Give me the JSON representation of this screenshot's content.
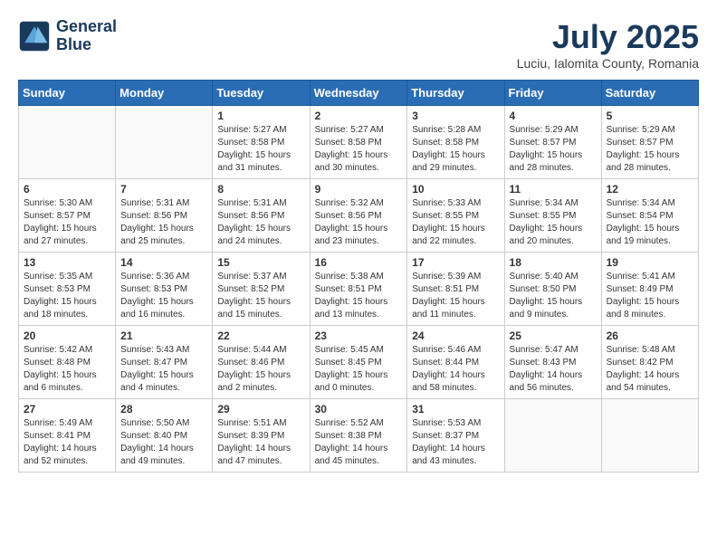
{
  "header": {
    "logo_line1": "General",
    "logo_line2": "Blue",
    "month_title": "July 2025",
    "location": "Luciu, Ialomita County, Romania"
  },
  "weekdays": [
    "Sunday",
    "Monday",
    "Tuesday",
    "Wednesday",
    "Thursday",
    "Friday",
    "Saturday"
  ],
  "weeks": [
    [
      {
        "day": "",
        "sunrise": "",
        "sunset": "",
        "daylight": ""
      },
      {
        "day": "",
        "sunrise": "",
        "sunset": "",
        "daylight": ""
      },
      {
        "day": "1",
        "sunrise": "Sunrise: 5:27 AM",
        "sunset": "Sunset: 8:58 PM",
        "daylight": "Daylight: 15 hours and 31 minutes."
      },
      {
        "day": "2",
        "sunrise": "Sunrise: 5:27 AM",
        "sunset": "Sunset: 8:58 PM",
        "daylight": "Daylight: 15 hours and 30 minutes."
      },
      {
        "day": "3",
        "sunrise": "Sunrise: 5:28 AM",
        "sunset": "Sunset: 8:58 PM",
        "daylight": "Daylight: 15 hours and 29 minutes."
      },
      {
        "day": "4",
        "sunrise": "Sunrise: 5:29 AM",
        "sunset": "Sunset: 8:57 PM",
        "daylight": "Daylight: 15 hours and 28 minutes."
      },
      {
        "day": "5",
        "sunrise": "Sunrise: 5:29 AM",
        "sunset": "Sunset: 8:57 PM",
        "daylight": "Daylight: 15 hours and 28 minutes."
      }
    ],
    [
      {
        "day": "6",
        "sunrise": "Sunrise: 5:30 AM",
        "sunset": "Sunset: 8:57 PM",
        "daylight": "Daylight: 15 hours and 27 minutes."
      },
      {
        "day": "7",
        "sunrise": "Sunrise: 5:31 AM",
        "sunset": "Sunset: 8:56 PM",
        "daylight": "Daylight: 15 hours and 25 minutes."
      },
      {
        "day": "8",
        "sunrise": "Sunrise: 5:31 AM",
        "sunset": "Sunset: 8:56 PM",
        "daylight": "Daylight: 15 hours and 24 minutes."
      },
      {
        "day": "9",
        "sunrise": "Sunrise: 5:32 AM",
        "sunset": "Sunset: 8:56 PM",
        "daylight": "Daylight: 15 hours and 23 minutes."
      },
      {
        "day": "10",
        "sunrise": "Sunrise: 5:33 AM",
        "sunset": "Sunset: 8:55 PM",
        "daylight": "Daylight: 15 hours and 22 minutes."
      },
      {
        "day": "11",
        "sunrise": "Sunrise: 5:34 AM",
        "sunset": "Sunset: 8:55 PM",
        "daylight": "Daylight: 15 hours and 20 minutes."
      },
      {
        "day": "12",
        "sunrise": "Sunrise: 5:34 AM",
        "sunset": "Sunset: 8:54 PM",
        "daylight": "Daylight: 15 hours and 19 minutes."
      }
    ],
    [
      {
        "day": "13",
        "sunrise": "Sunrise: 5:35 AM",
        "sunset": "Sunset: 8:53 PM",
        "daylight": "Daylight: 15 hours and 18 minutes."
      },
      {
        "day": "14",
        "sunrise": "Sunrise: 5:36 AM",
        "sunset": "Sunset: 8:53 PM",
        "daylight": "Daylight: 15 hours and 16 minutes."
      },
      {
        "day": "15",
        "sunrise": "Sunrise: 5:37 AM",
        "sunset": "Sunset: 8:52 PM",
        "daylight": "Daylight: 15 hours and 15 minutes."
      },
      {
        "day": "16",
        "sunrise": "Sunrise: 5:38 AM",
        "sunset": "Sunset: 8:51 PM",
        "daylight": "Daylight: 15 hours and 13 minutes."
      },
      {
        "day": "17",
        "sunrise": "Sunrise: 5:39 AM",
        "sunset": "Sunset: 8:51 PM",
        "daylight": "Daylight: 15 hours and 11 minutes."
      },
      {
        "day": "18",
        "sunrise": "Sunrise: 5:40 AM",
        "sunset": "Sunset: 8:50 PM",
        "daylight": "Daylight: 15 hours and 9 minutes."
      },
      {
        "day": "19",
        "sunrise": "Sunrise: 5:41 AM",
        "sunset": "Sunset: 8:49 PM",
        "daylight": "Daylight: 15 hours and 8 minutes."
      }
    ],
    [
      {
        "day": "20",
        "sunrise": "Sunrise: 5:42 AM",
        "sunset": "Sunset: 8:48 PM",
        "daylight": "Daylight: 15 hours and 6 minutes."
      },
      {
        "day": "21",
        "sunrise": "Sunrise: 5:43 AM",
        "sunset": "Sunset: 8:47 PM",
        "daylight": "Daylight: 15 hours and 4 minutes."
      },
      {
        "day": "22",
        "sunrise": "Sunrise: 5:44 AM",
        "sunset": "Sunset: 8:46 PM",
        "daylight": "Daylight: 15 hours and 2 minutes."
      },
      {
        "day": "23",
        "sunrise": "Sunrise: 5:45 AM",
        "sunset": "Sunset: 8:45 PM",
        "daylight": "Daylight: 15 hours and 0 minutes."
      },
      {
        "day": "24",
        "sunrise": "Sunrise: 5:46 AM",
        "sunset": "Sunset: 8:44 PM",
        "daylight": "Daylight: 14 hours and 58 minutes."
      },
      {
        "day": "25",
        "sunrise": "Sunrise: 5:47 AM",
        "sunset": "Sunset: 8:43 PM",
        "daylight": "Daylight: 14 hours and 56 minutes."
      },
      {
        "day": "26",
        "sunrise": "Sunrise: 5:48 AM",
        "sunset": "Sunset: 8:42 PM",
        "daylight": "Daylight: 14 hours and 54 minutes."
      }
    ],
    [
      {
        "day": "27",
        "sunrise": "Sunrise: 5:49 AM",
        "sunset": "Sunset: 8:41 PM",
        "daylight": "Daylight: 14 hours and 52 minutes."
      },
      {
        "day": "28",
        "sunrise": "Sunrise: 5:50 AM",
        "sunset": "Sunset: 8:40 PM",
        "daylight": "Daylight: 14 hours and 49 minutes."
      },
      {
        "day": "29",
        "sunrise": "Sunrise: 5:51 AM",
        "sunset": "Sunset: 8:39 PM",
        "daylight": "Daylight: 14 hours and 47 minutes."
      },
      {
        "day": "30",
        "sunrise": "Sunrise: 5:52 AM",
        "sunset": "Sunset: 8:38 PM",
        "daylight": "Daylight: 14 hours and 45 minutes."
      },
      {
        "day": "31",
        "sunrise": "Sunrise: 5:53 AM",
        "sunset": "Sunset: 8:37 PM",
        "daylight": "Daylight: 14 hours and 43 minutes."
      },
      {
        "day": "",
        "sunrise": "",
        "sunset": "",
        "daylight": ""
      },
      {
        "day": "",
        "sunrise": "",
        "sunset": "",
        "daylight": ""
      }
    ]
  ]
}
